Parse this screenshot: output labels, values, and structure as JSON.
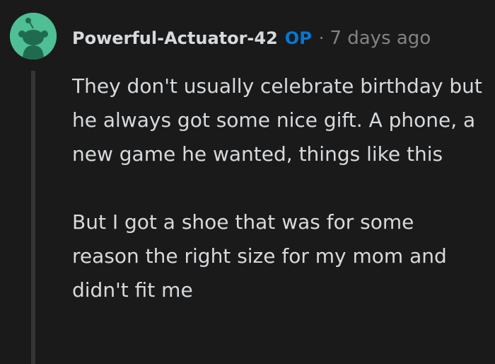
{
  "comment": {
    "author": "Powerful-Actuator-42",
    "op_badge": "OP",
    "separator": "·",
    "timestamp": "7 days ago",
    "avatar_icon": "snoo-avatar-icon",
    "paragraphs": [
      "They don't usually celebrate birthday but he always got some nice gift. A phone, a new game he wanted, things like this",
      "But I got a shoe that was for some reason the right size for my mom and didn't fit me"
    ]
  },
  "colors": {
    "background": "#1a1a1b",
    "text": "#d7dadc",
    "op_badge": "#0079d3",
    "muted": "#818384",
    "avatar_bg": "#4fbf95",
    "thread_line": "#343536"
  }
}
